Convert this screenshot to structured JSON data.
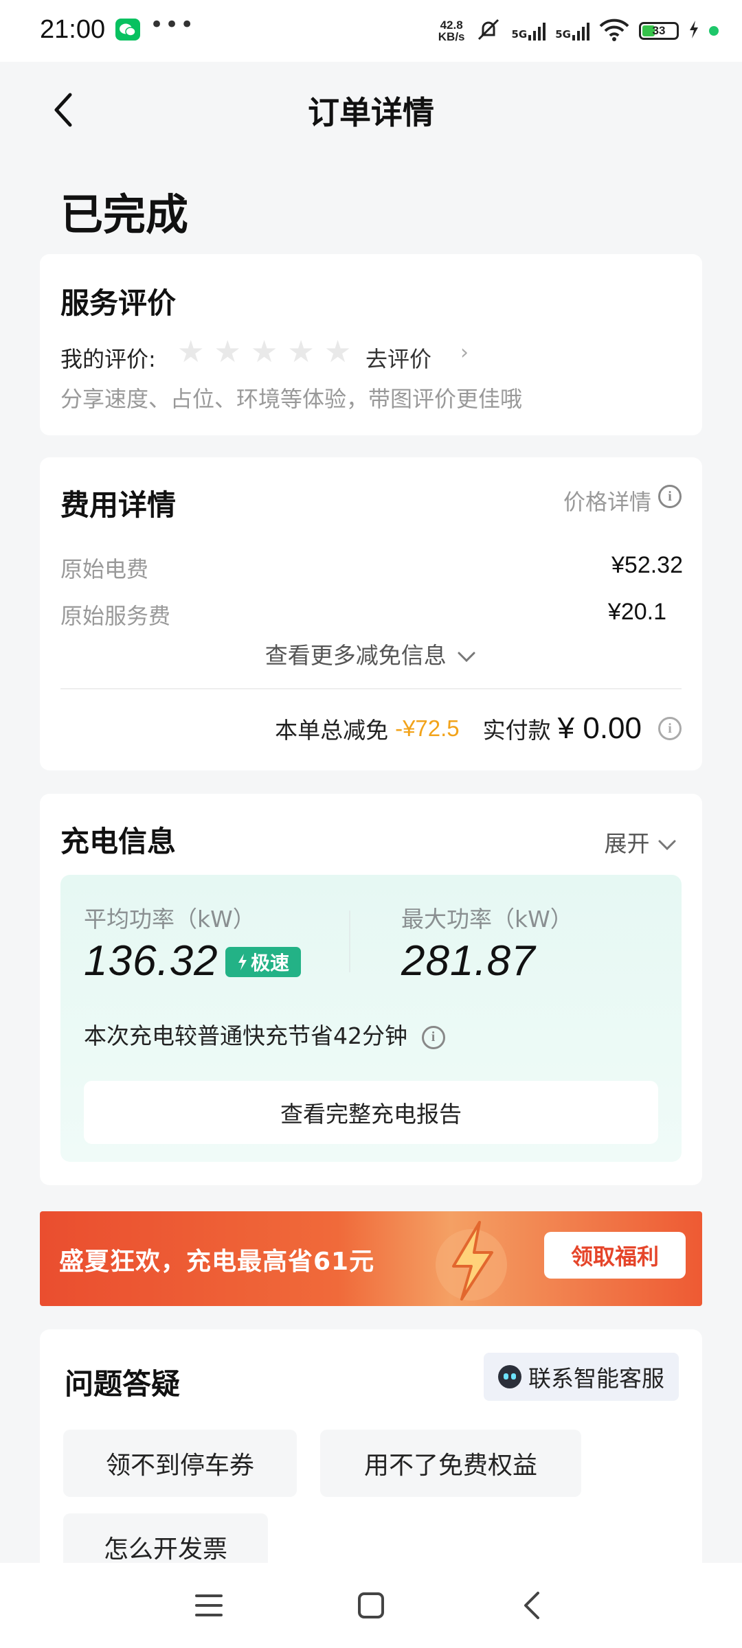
{
  "status_bar": {
    "time": "21:00",
    "speed_value": "42.8",
    "speed_unit": "KB/s",
    "sim1": "5G",
    "sim2": "5G",
    "battery": "33"
  },
  "header": {
    "title": "订单详情"
  },
  "order_status": "已完成",
  "review": {
    "title": "服务评价",
    "my_rating_label": "我的评价:",
    "rating": 0,
    "max_rating": 5,
    "go_review": "去评价",
    "hint": "分享速度、占位、环境等体验，带图评价更佳哦"
  },
  "fees": {
    "title": "费用详情",
    "price_detail": "价格详情",
    "rows": [
      {
        "label": "原始电费",
        "value": "¥52.32"
      },
      {
        "label": "原始服务费",
        "value": "¥20.1"
      }
    ],
    "more_discount": "查看更多减免信息",
    "total_discount_label": "本单总减免",
    "total_discount": "-¥72.5",
    "paid_label": "实付款",
    "paid_amount": "¥ 0.00"
  },
  "charging": {
    "title": "充电信息",
    "expand": "展开",
    "avg_power_label": "平均功率（kW）",
    "avg_power": "136.32",
    "fast_badge": "极速",
    "max_power_label": "最大功率（kW）",
    "max_power": "281.87",
    "saved_text": "本次充电较普通快充节省42分钟",
    "report_button": "查看完整充电报告"
  },
  "promo": {
    "text": "盛夏狂欢，充电最高省61元",
    "button": "领取福利"
  },
  "faq": {
    "title": "问题答疑",
    "customer_service": "联系智能客服",
    "chips": [
      "领不到停车券",
      "用不了免费权益",
      "怎么开发票"
    ]
  },
  "colors": {
    "accent_green": "#23b286",
    "discount_orange": "#f2a31a",
    "promo_red": "#ea4e2f"
  }
}
